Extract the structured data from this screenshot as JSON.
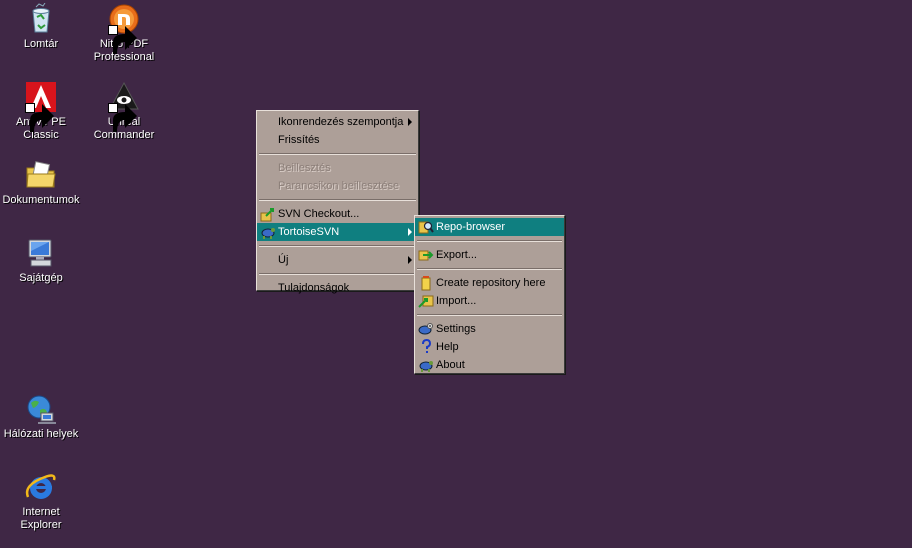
{
  "desktop": {
    "background": "#3f2745",
    "icons": [
      {
        "label": "Lomtár"
      },
      {
        "label": "Nitro PDF\nProfessional"
      },
      {
        "label": "AntiVir PE\nClassic"
      },
      {
        "label": "Unreal\nCommander"
      },
      {
        "label": "Dokumentumok"
      },
      {
        "label": "Sajátgép"
      },
      {
        "label": "Hálózati helyek"
      },
      {
        "label": "Internet\nExplorer"
      }
    ]
  },
  "context_menu": {
    "items": [
      {
        "label": "Ikonrendezés szempontja"
      },
      {
        "label": "Frissítés"
      },
      {
        "label": "Beillesztés"
      },
      {
        "label": "Parancsikon beillesztése"
      },
      {
        "label": "SVN Checkout..."
      },
      {
        "label": "TortoiseSVN"
      },
      {
        "label": "Új"
      },
      {
        "label": "Tulajdonságok"
      }
    ]
  },
  "submenu": {
    "items": [
      {
        "label": "Repo-browser"
      },
      {
        "label": "Export..."
      },
      {
        "label": "Create repository here"
      },
      {
        "label": "Import..."
      },
      {
        "label": "Settings"
      },
      {
        "label": "Help"
      },
      {
        "label": "About"
      }
    ]
  },
  "colors": {
    "menu_background": "#ad9f98",
    "selection": "#0f7f80",
    "disabled_text": "#8c7f79"
  }
}
